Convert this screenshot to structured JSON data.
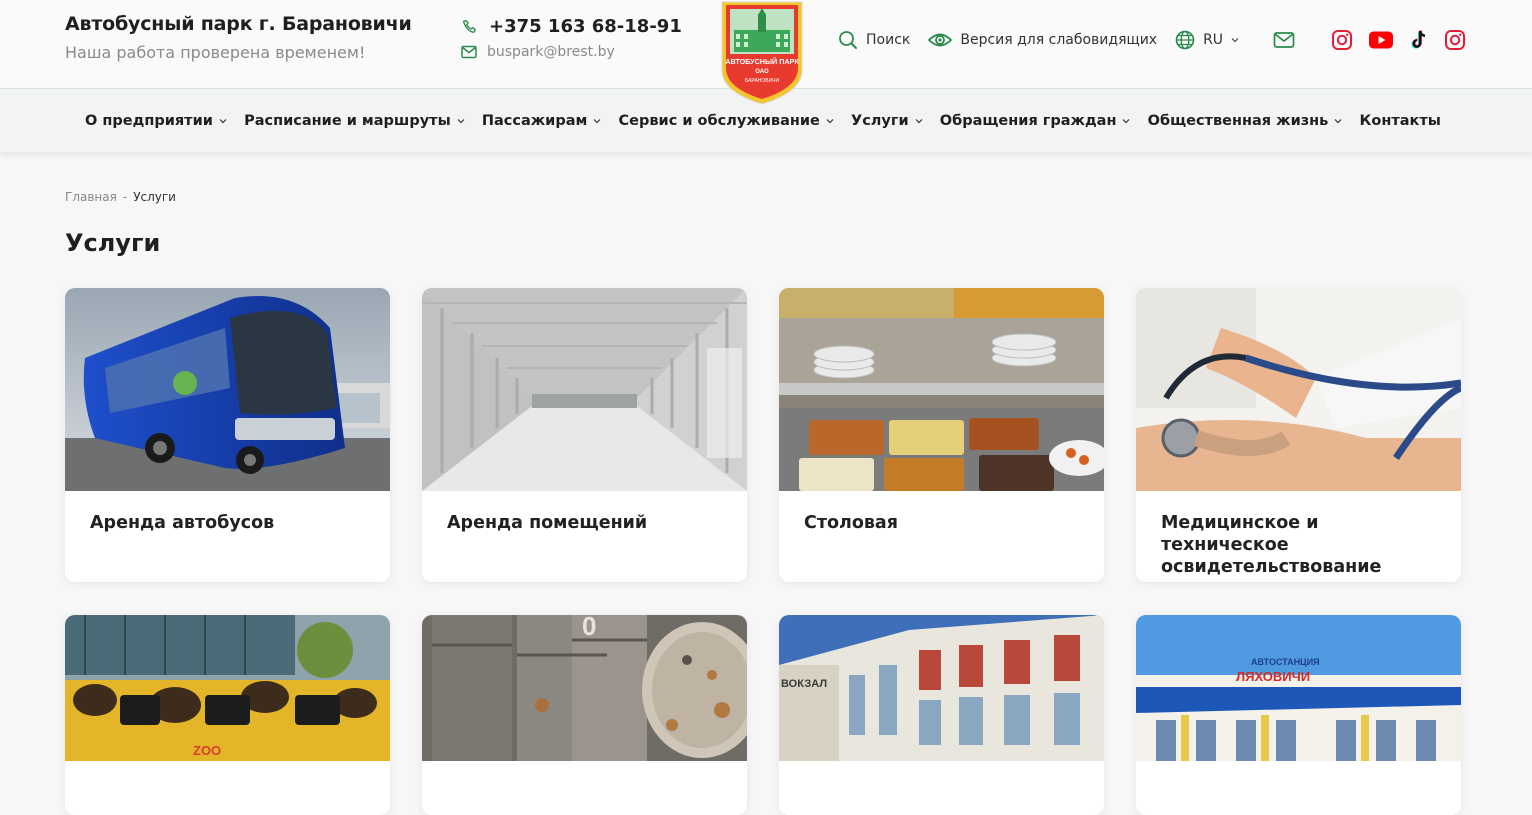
{
  "header": {
    "title": "Автобусный парк г. Барановичи",
    "slogan": "Наша работа проверена временем!",
    "phone": "+375 163 68-18-91",
    "email": "buspark@brest.by",
    "logo_text_main": "АВТОБУСНЫЙ ПАРК",
    "logo_text_oao": "ОАО",
    "logo_text_city": "БАРАНОВИЧИ",
    "search_label": "Поиск",
    "vision_label": "Версия для слабовидящих",
    "lang_label": "RU",
    "social_icons": [
      "instagram-icon",
      "youtube-icon",
      "tiktok-icon",
      "instagram-icon"
    ]
  },
  "nav": {
    "items": [
      {
        "label": "О предприятии",
        "has_dropdown": true
      },
      {
        "label": "Расписание и маршруты",
        "has_dropdown": true
      },
      {
        "label": "Пассажирам",
        "has_dropdown": true
      },
      {
        "label": "Сервис и обслуживание",
        "has_dropdown": true
      },
      {
        "label": "Услуги",
        "has_dropdown": true
      },
      {
        "label": "Обращения граждан",
        "has_dropdown": true
      },
      {
        "label": "Общественная жизнь",
        "has_dropdown": true
      },
      {
        "label": "Контакты",
        "has_dropdown": false
      }
    ]
  },
  "breadcrumb": {
    "home": "Главная",
    "separator": "-",
    "current": "Услуги"
  },
  "page": {
    "title": "Услуги"
  },
  "cards": [
    {
      "label": "Аренда автобусов",
      "image": "blue coach bus"
    },
    {
      "label": "Аренда помещений",
      "image": "empty industrial hall"
    },
    {
      "label": "Столовая",
      "image": "canteen buffet trays"
    },
    {
      "label": "Медицинское и техническое освидетельствование",
      "image": "blood pressure measurement"
    },
    {
      "label": "",
      "image": "bus with python wrap"
    },
    {
      "label": "",
      "image": "rusty barrels"
    },
    {
      "label": "",
      "image": "railway station building"
    },
    {
      "label": "",
      "image": "bus station building"
    }
  ],
  "card_row2_texts": {
    "zoo": "ZOO",
    "vokzal": "ВОКЗАЛ",
    "avtostanciya": "АВТОСТАНЦИЯ",
    "lyakhovichi": "ЛЯХОВИЧИ"
  },
  "colors": {
    "accent_green": "#2a8a4a",
    "icon_red": "#e0203a",
    "youtube_red": "#ff0000",
    "nav_bg": "#f1f4f2",
    "page_bg": "#f7f7f7"
  }
}
